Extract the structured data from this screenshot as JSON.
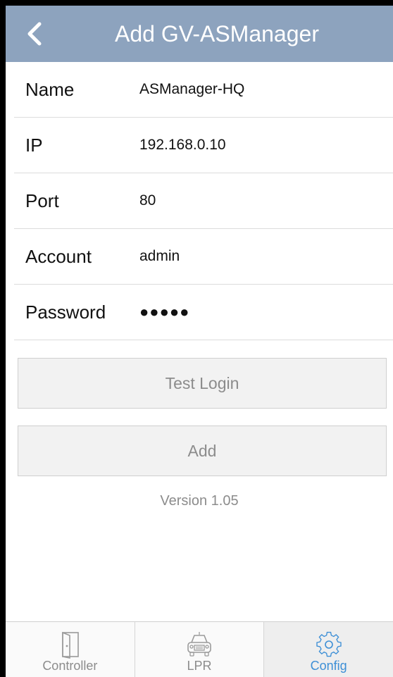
{
  "header": {
    "title": "Add GV-ASManager",
    "back_icon": "chevron-left-icon"
  },
  "form": {
    "rows": [
      {
        "label": "Name",
        "value": "ASManager-HQ"
      },
      {
        "label": "IP",
        "value": "192.168.0.10"
      },
      {
        "label": "Port",
        "value": "80"
      },
      {
        "label": "Account",
        "value": "admin"
      },
      {
        "label": "Password",
        "value": "●●●●●"
      }
    ]
  },
  "buttons": {
    "test_login": "Test Login",
    "add": "Add"
  },
  "version": "Version 1.05",
  "tabbar": {
    "active": "Config",
    "tabs": [
      {
        "label": "Controller",
        "icon": "door-icon"
      },
      {
        "label": "LPR",
        "icon": "car-icon"
      },
      {
        "label": "Config",
        "icon": "gear-icon"
      }
    ]
  },
  "colors": {
    "header_bg": "#8da3be",
    "active_tab": "#3d8fd6",
    "inactive_text": "#8c8c8c"
  }
}
